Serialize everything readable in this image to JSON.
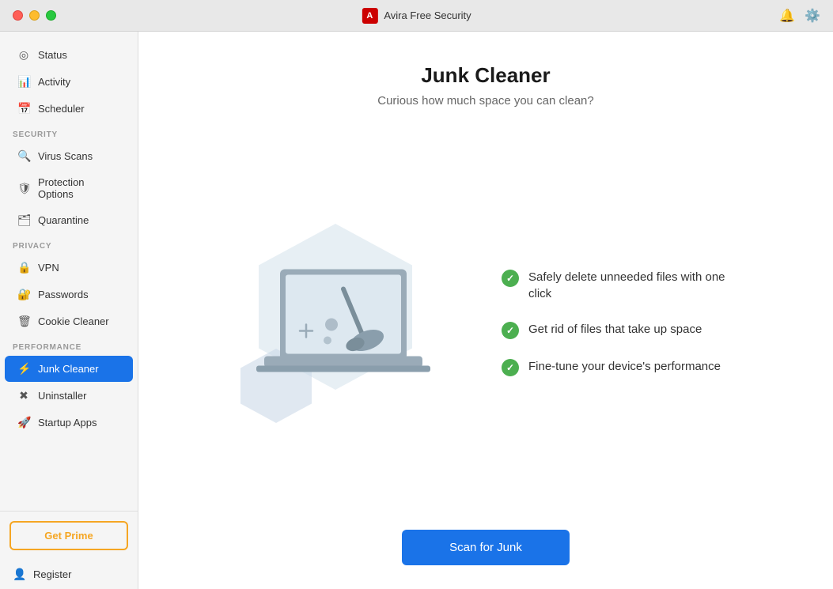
{
  "titlebar": {
    "title": "Avira Free Security",
    "logo_text": "A"
  },
  "sidebar": {
    "top_items": [
      {
        "id": "status",
        "label": "Status",
        "icon": "◎"
      },
      {
        "id": "activity",
        "label": "Activity",
        "icon": "📊"
      },
      {
        "id": "scheduler",
        "label": "Scheduler",
        "icon": "📅"
      }
    ],
    "security_section": "SECURITY",
    "security_items": [
      {
        "id": "virus-scans",
        "label": "Virus Scans",
        "icon": "🔍"
      },
      {
        "id": "protection-options",
        "label": "Protection Options",
        "icon": "🛡"
      },
      {
        "id": "quarantine",
        "label": "Quarantine",
        "icon": "🗂"
      }
    ],
    "privacy_section": "PRIVACY",
    "privacy_items": [
      {
        "id": "vpn",
        "label": "VPN",
        "icon": "🔒"
      },
      {
        "id": "passwords",
        "label": "Passwords",
        "icon": "🔐"
      },
      {
        "id": "cookie-cleaner",
        "label": "Cookie Cleaner",
        "icon": "🗑"
      }
    ],
    "performance_section": "PERFORMANCE",
    "performance_items": [
      {
        "id": "junk-cleaner",
        "label": "Junk Cleaner",
        "icon": "⚡",
        "active": true
      },
      {
        "id": "uninstaller",
        "label": "Uninstaller",
        "icon": "✖"
      },
      {
        "id": "startup-apps",
        "label": "Startup Apps",
        "icon": "🚀"
      }
    ],
    "get_prime_label": "Get Prime",
    "register_label": "Register",
    "register_icon": "👤"
  },
  "main": {
    "title": "Junk Cleaner",
    "subtitle": "Curious how much space you can clean?",
    "features": [
      {
        "id": "f1",
        "text": "Safely delete unneeded files with one click"
      },
      {
        "id": "f2",
        "text": "Get rid of files that take up space"
      },
      {
        "id": "f3",
        "text": "Fine-tune your device's performance"
      }
    ],
    "scan_button_label": "Scan for Junk"
  }
}
